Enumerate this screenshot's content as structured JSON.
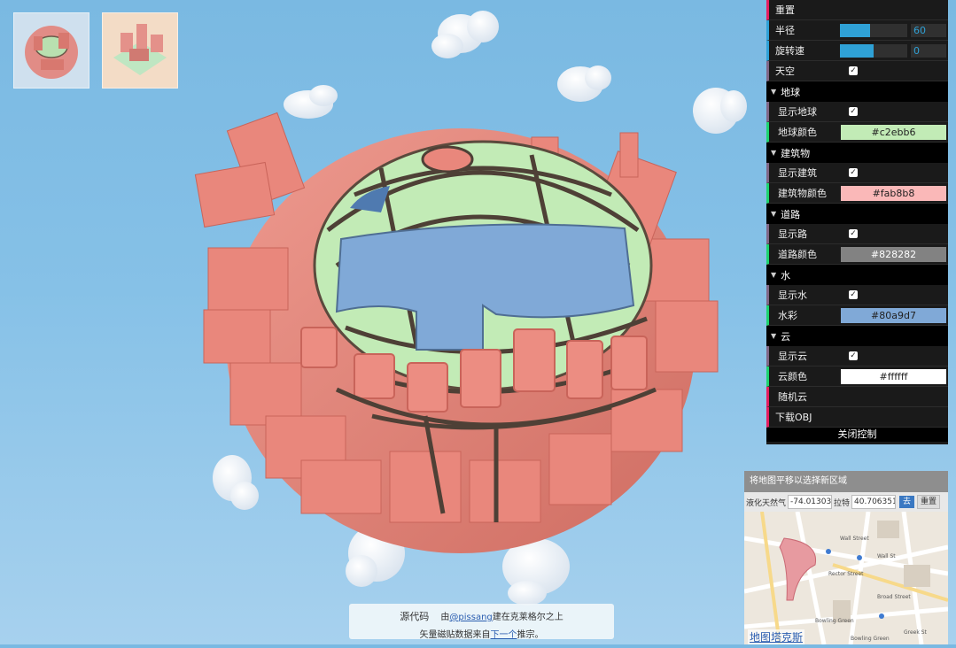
{
  "thumbnails": [
    {
      "name": "thumbnail-1"
    },
    {
      "name": "thumbnail-2"
    }
  ],
  "controls": {
    "reset": "重置",
    "radius": {
      "label": "半径",
      "value": "60",
      "fill": 0.45
    },
    "rotation": {
      "label": "旋转速",
      "value": "0",
      "fill": 0.5
    },
    "sky": {
      "label": "天空",
      "checked": true
    },
    "earth": {
      "folder": "地球",
      "show": {
        "label": "显示地球",
        "checked": true
      },
      "color": {
        "label": "地球颜色",
        "value": "#c2ebb6"
      }
    },
    "buildings": {
      "folder": "建筑物",
      "show": {
        "label": "显示建筑",
        "checked": true
      },
      "color": {
        "label": "建筑物颜色",
        "value": "#fab8b8"
      }
    },
    "roads": {
      "folder": "道路",
      "show": {
        "label": "显示路",
        "checked": true
      },
      "color": {
        "label": "道路颜色",
        "value": "#828282"
      }
    },
    "water": {
      "folder": "水",
      "show": {
        "label": "显示水",
        "checked": true
      },
      "color": {
        "label": "水彩",
        "value": "#80a9d7"
      }
    },
    "clouds": {
      "folder": "云",
      "show": {
        "label": "显示云",
        "checked": true
      },
      "color": {
        "label": "云颜色",
        "value": "#ffffff"
      },
      "random": "随机云"
    },
    "download": "下载OBJ",
    "close": "关闭控制"
  },
  "map": {
    "header": "将地图平移以选择新区域",
    "lon_label": "液化天然气",
    "lon_value": "-74.0130345",
    "lat_label": "拉特",
    "lat_value": "40.7063516",
    "go": "去",
    "reset": "重置",
    "link": "地图塔克斯",
    "labels": [
      "Wall Street",
      "Wall St",
      "Rector Street",
      "Broad Street",
      "Bowling Green",
      "Greek St",
      "Bowling Green"
    ]
  },
  "credits": {
    "source": "源代码",
    "by_prefix": "由",
    "author": "@pissang",
    "by_suffix": "建在克莱格尔之上",
    "data_prefix": "矢量磁贴数据来自",
    "data_link": "下一个",
    "data_suffix": "推宗。"
  },
  "colors": {
    "earth": "#c2ebb6",
    "building": "#fab8b8",
    "road": "#828282",
    "water": "#80a9d7",
    "cloud": "#ffffff"
  }
}
